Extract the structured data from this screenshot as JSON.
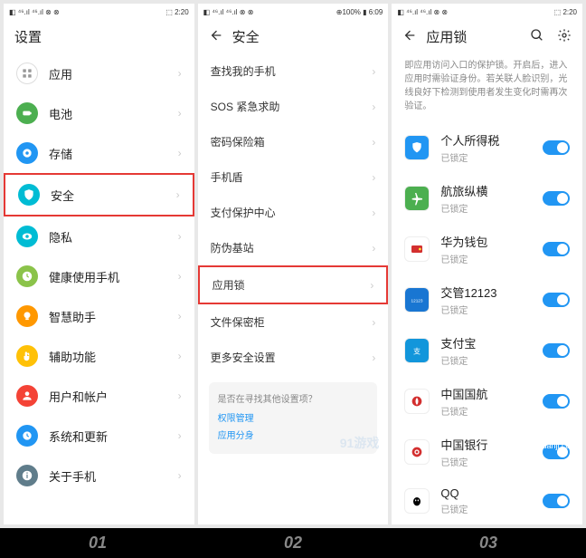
{
  "status": {
    "left": "◧ ⁴⁶.ıl ⁴⁶.ıl ⊗ ⊗",
    "time1": "⬚ 2:20",
    "time2": "⊕100% ▮ 6:09",
    "time3": "⬚ 2:20"
  },
  "p1": {
    "title": "设置",
    "items": [
      {
        "label": "应用",
        "color": "#fff",
        "iconStroke": "#ccc"
      },
      {
        "label": "电池",
        "color": "#4caf50"
      },
      {
        "label": "存储",
        "color": "#2196f3"
      },
      {
        "label": "安全",
        "color": "#00bcd4",
        "hl": true
      },
      {
        "label": "隐私",
        "color": "#00bcd4"
      },
      {
        "label": "健康使用手机",
        "color": "#8bc34a"
      },
      {
        "label": "智慧助手",
        "color": "#ff9800"
      },
      {
        "label": "辅助功能",
        "color": "#ffc107"
      },
      {
        "label": "用户和帐户",
        "color": "#f44336"
      },
      {
        "label": "系统和更新",
        "color": "#2196f3"
      },
      {
        "label": "关于手机",
        "color": "#607d8b"
      }
    ]
  },
  "p2": {
    "title": "安全",
    "items": [
      "查找我的手机",
      "SOS 紧急求助",
      "密码保险箱",
      "手机盾",
      "支付保护中心",
      "防伪基站",
      "应用锁",
      "文件保密柜",
      "更多安全设置"
    ],
    "hlIdx": 6,
    "info": {
      "title": "是否在寻找其他设置项？",
      "links": [
        "权限管理",
        "应用分身"
      ]
    },
    "wm": "91游戏"
  },
  "p3": {
    "title": "应用锁",
    "desc": "即应用访问入口的保护锁。开启后，进入应用时需验证身份。若关联人脸识别，光线良好下检测到使用者发生变化时需再次验证。",
    "apps": [
      {
        "label": "个人所得税",
        "sub": "已锁定",
        "bg": "#2196f3",
        "ic": "shield"
      },
      {
        "label": "航旅纵横",
        "sub": "已锁定",
        "bg": "#4caf50",
        "ic": "plane"
      },
      {
        "label": "华为钱包",
        "sub": "已锁定",
        "bg": "#fff",
        "ic": "wallet"
      },
      {
        "label": "交管12123",
        "sub": "已锁定",
        "bg": "#1976d2",
        "ic": "num"
      },
      {
        "label": "支付宝",
        "sub": "已锁定",
        "bg": "#1296db",
        "ic": "ali"
      },
      {
        "label": "中国国航",
        "sub": "已锁定",
        "bg": "#fff",
        "ic": "air"
      },
      {
        "label": "中国银行",
        "sub": "已锁定",
        "bg": "#fff",
        "ic": "bank"
      },
      {
        "label": "QQ",
        "sub": "已锁定",
        "bg": "#fff",
        "ic": "qq"
      }
    ]
  },
  "steps": [
    "01",
    "02",
    "03"
  ],
  "footer": {
    "wm": "91 游戏",
    "url": "91danji.com"
  }
}
